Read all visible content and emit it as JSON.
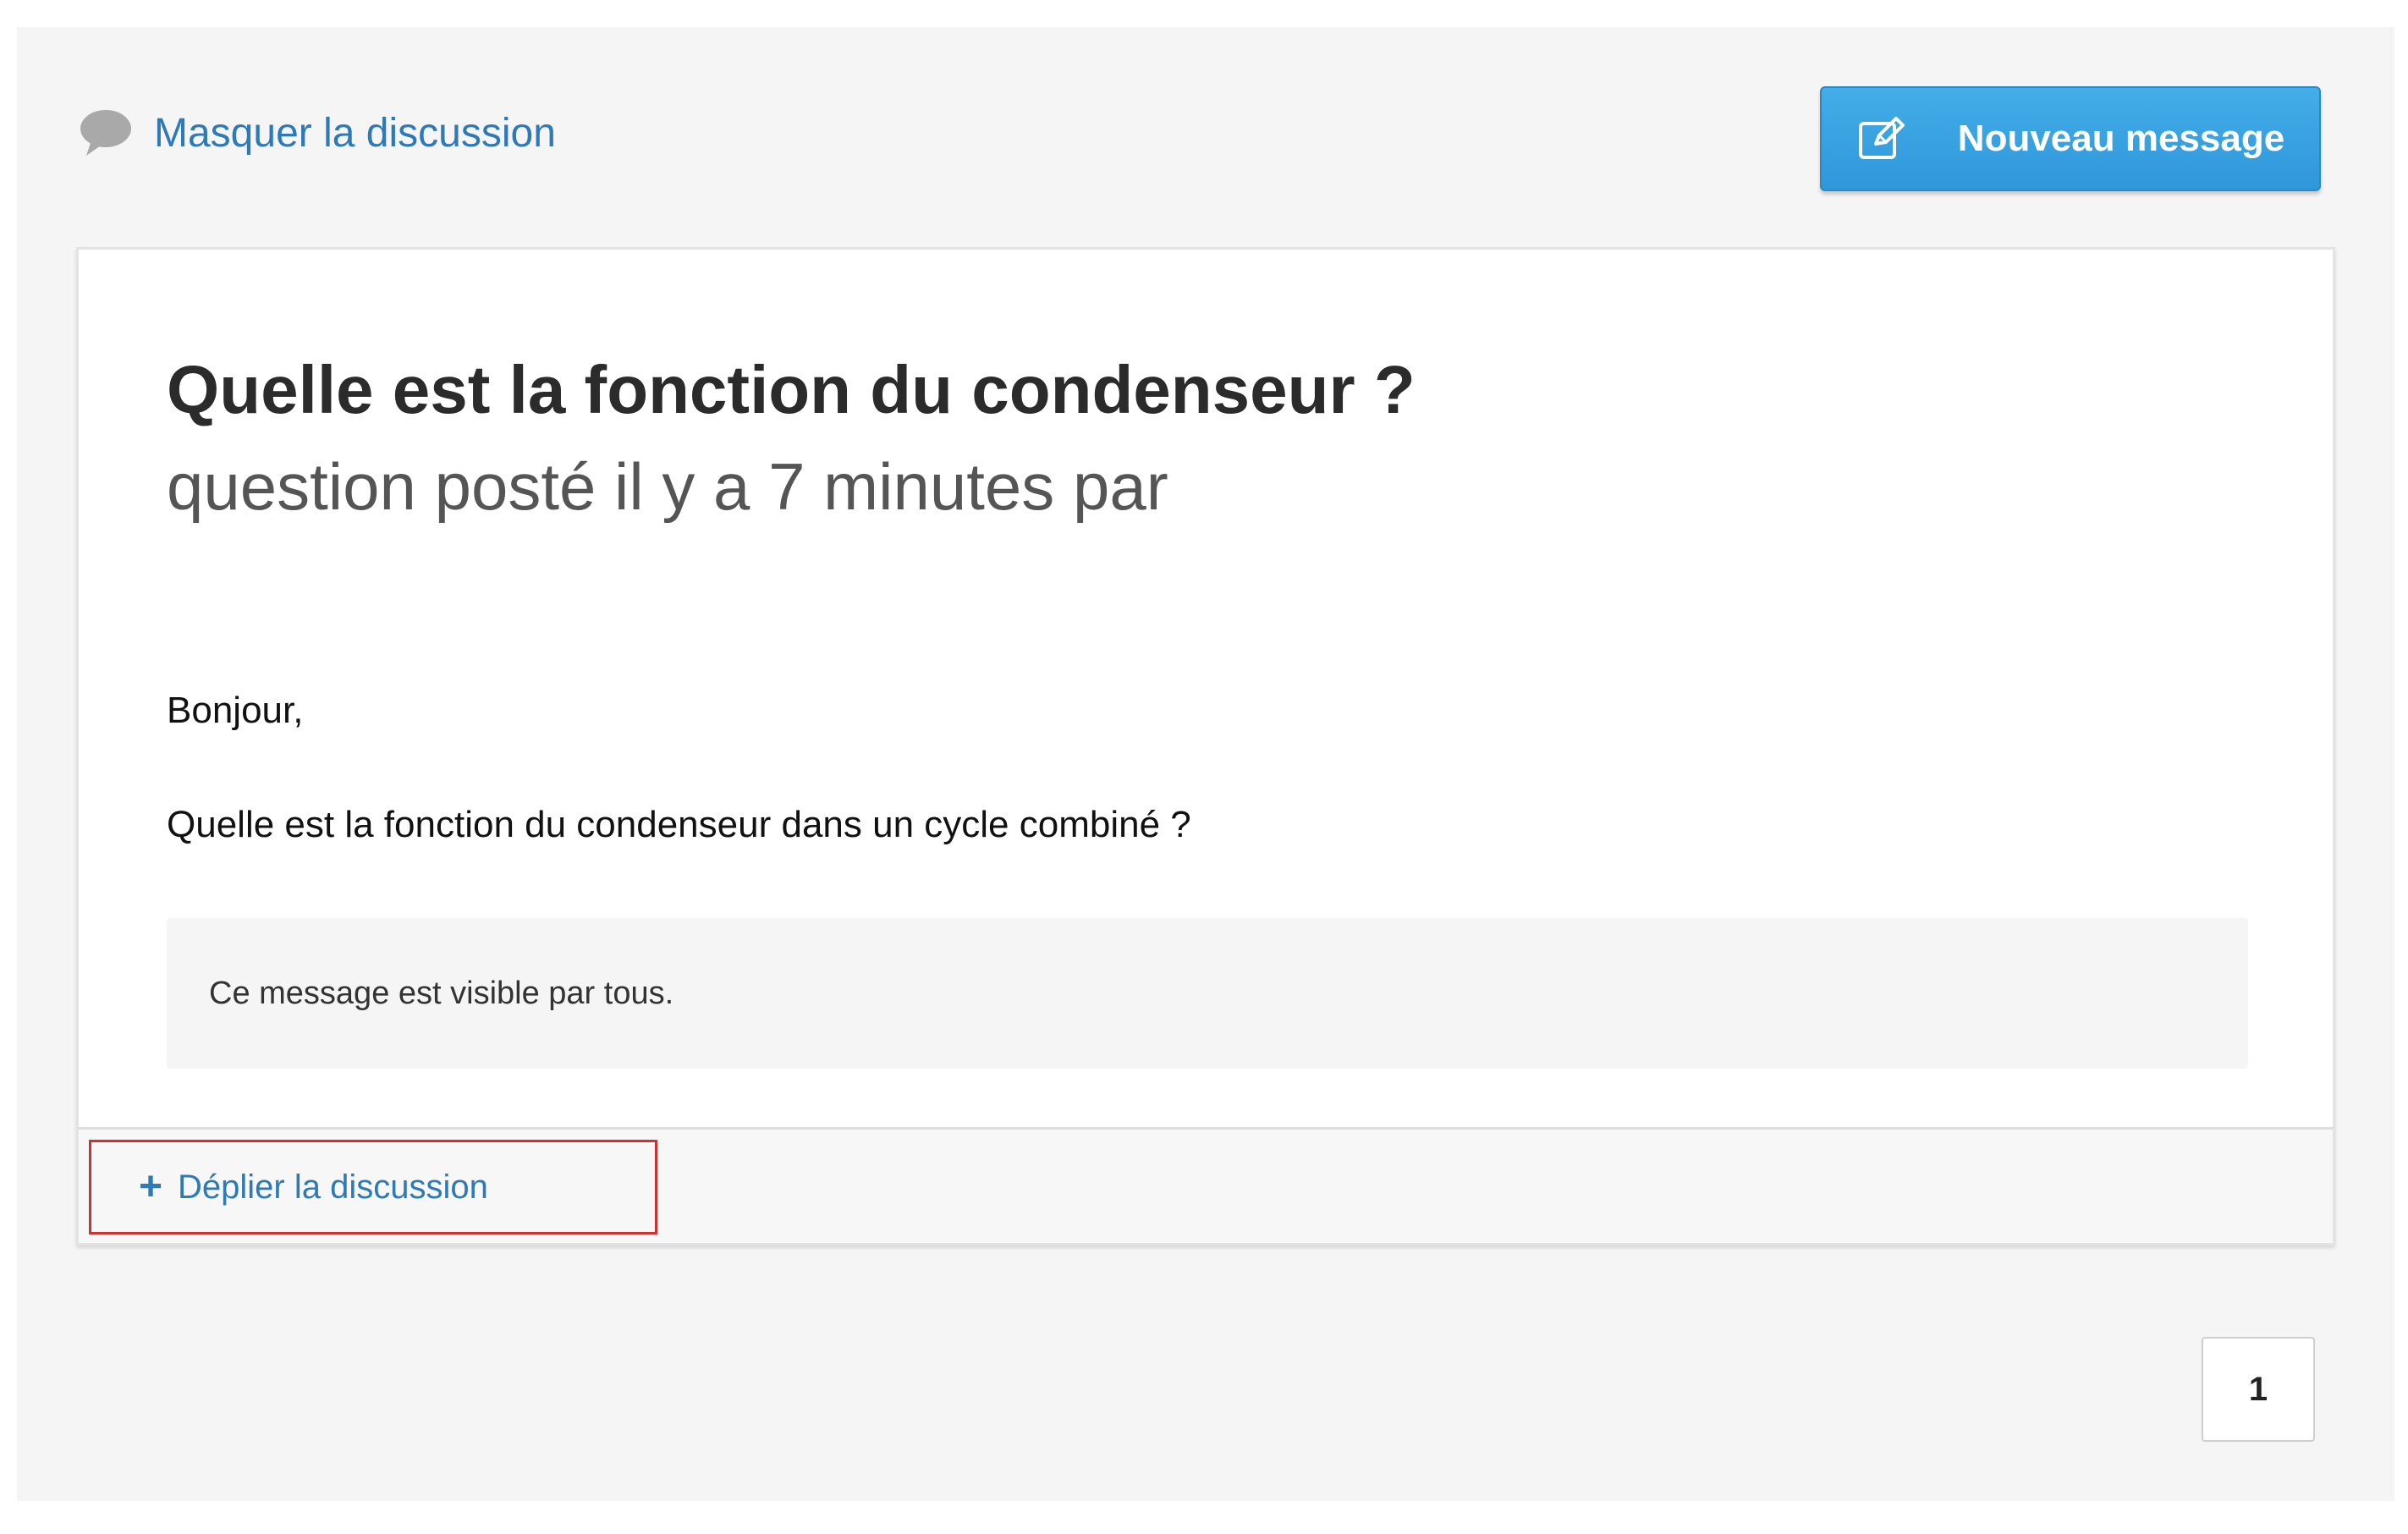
{
  "header": {
    "hide_discussion_label": "Masquer la discussion",
    "new_message_label": "Nouveau message",
    "icons": {
      "hide": "speech-bubble-icon",
      "new_message": "pencil-edit-icon"
    }
  },
  "post": {
    "title": "Quelle est la fonction du condenseur ?",
    "subtitle": "question posté il y a 7 minutes par",
    "greeting": "Bonjour,",
    "body": "Quelle est la fonction du condenseur dans un cycle combiné ?",
    "visibility_note": "Ce message est visible par tous."
  },
  "footer": {
    "expand_icon": "+",
    "expand_label": "Déplier la discussion"
  },
  "pagination": {
    "current_page": "1"
  },
  "colors": {
    "link": "#2e7ab8",
    "button": "#3aa5e4",
    "highlight_border": "#d0302f",
    "panel_bg": "#f5f5f5"
  }
}
